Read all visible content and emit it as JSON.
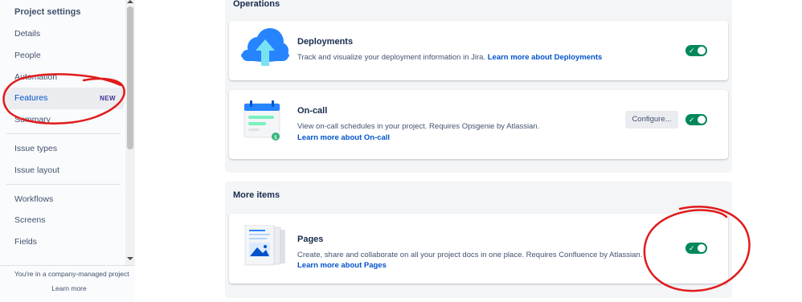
{
  "sidebar": {
    "heading": "Project settings",
    "items": [
      {
        "label": "Details"
      },
      {
        "label": "People"
      },
      {
        "label": "Automation"
      },
      {
        "label": "Features",
        "badge": "NEW",
        "active": true
      },
      {
        "label": "Summary"
      },
      {
        "label": "Issue types"
      },
      {
        "label": "Issue layout"
      },
      {
        "label": "Workflows"
      },
      {
        "label": "Screens"
      },
      {
        "label": "Fields"
      }
    ],
    "footer_text": "You're in a company-managed project",
    "footer_link": "Learn more"
  },
  "operations": {
    "title": "Operations",
    "deployments": {
      "icon": "cloud-upload-icon",
      "title": "Deployments",
      "desc": "Track and visualize your deployment information in Jira. ",
      "link": "Learn more about Deployments",
      "enabled": true
    },
    "oncall": {
      "icon": "calendar-icon",
      "title": "On-call",
      "desc": "View on-call schedules in your project. Requires Opsgenie by Atlassian.",
      "link": "Learn more about On-call",
      "configure_label": "Configure...",
      "enabled": true
    }
  },
  "more_items": {
    "title": "More items",
    "pages": {
      "icon": "pages-icon",
      "title": "Pages",
      "desc": "Create, share and collaborate on all your project docs in one place. Requires Confluence by Atlassian.",
      "link": "Learn more about Pages",
      "enabled": true
    }
  },
  "colors": {
    "toggle_on": "#00875a",
    "link": "#0052cc",
    "annotation": "#e01b1b"
  }
}
